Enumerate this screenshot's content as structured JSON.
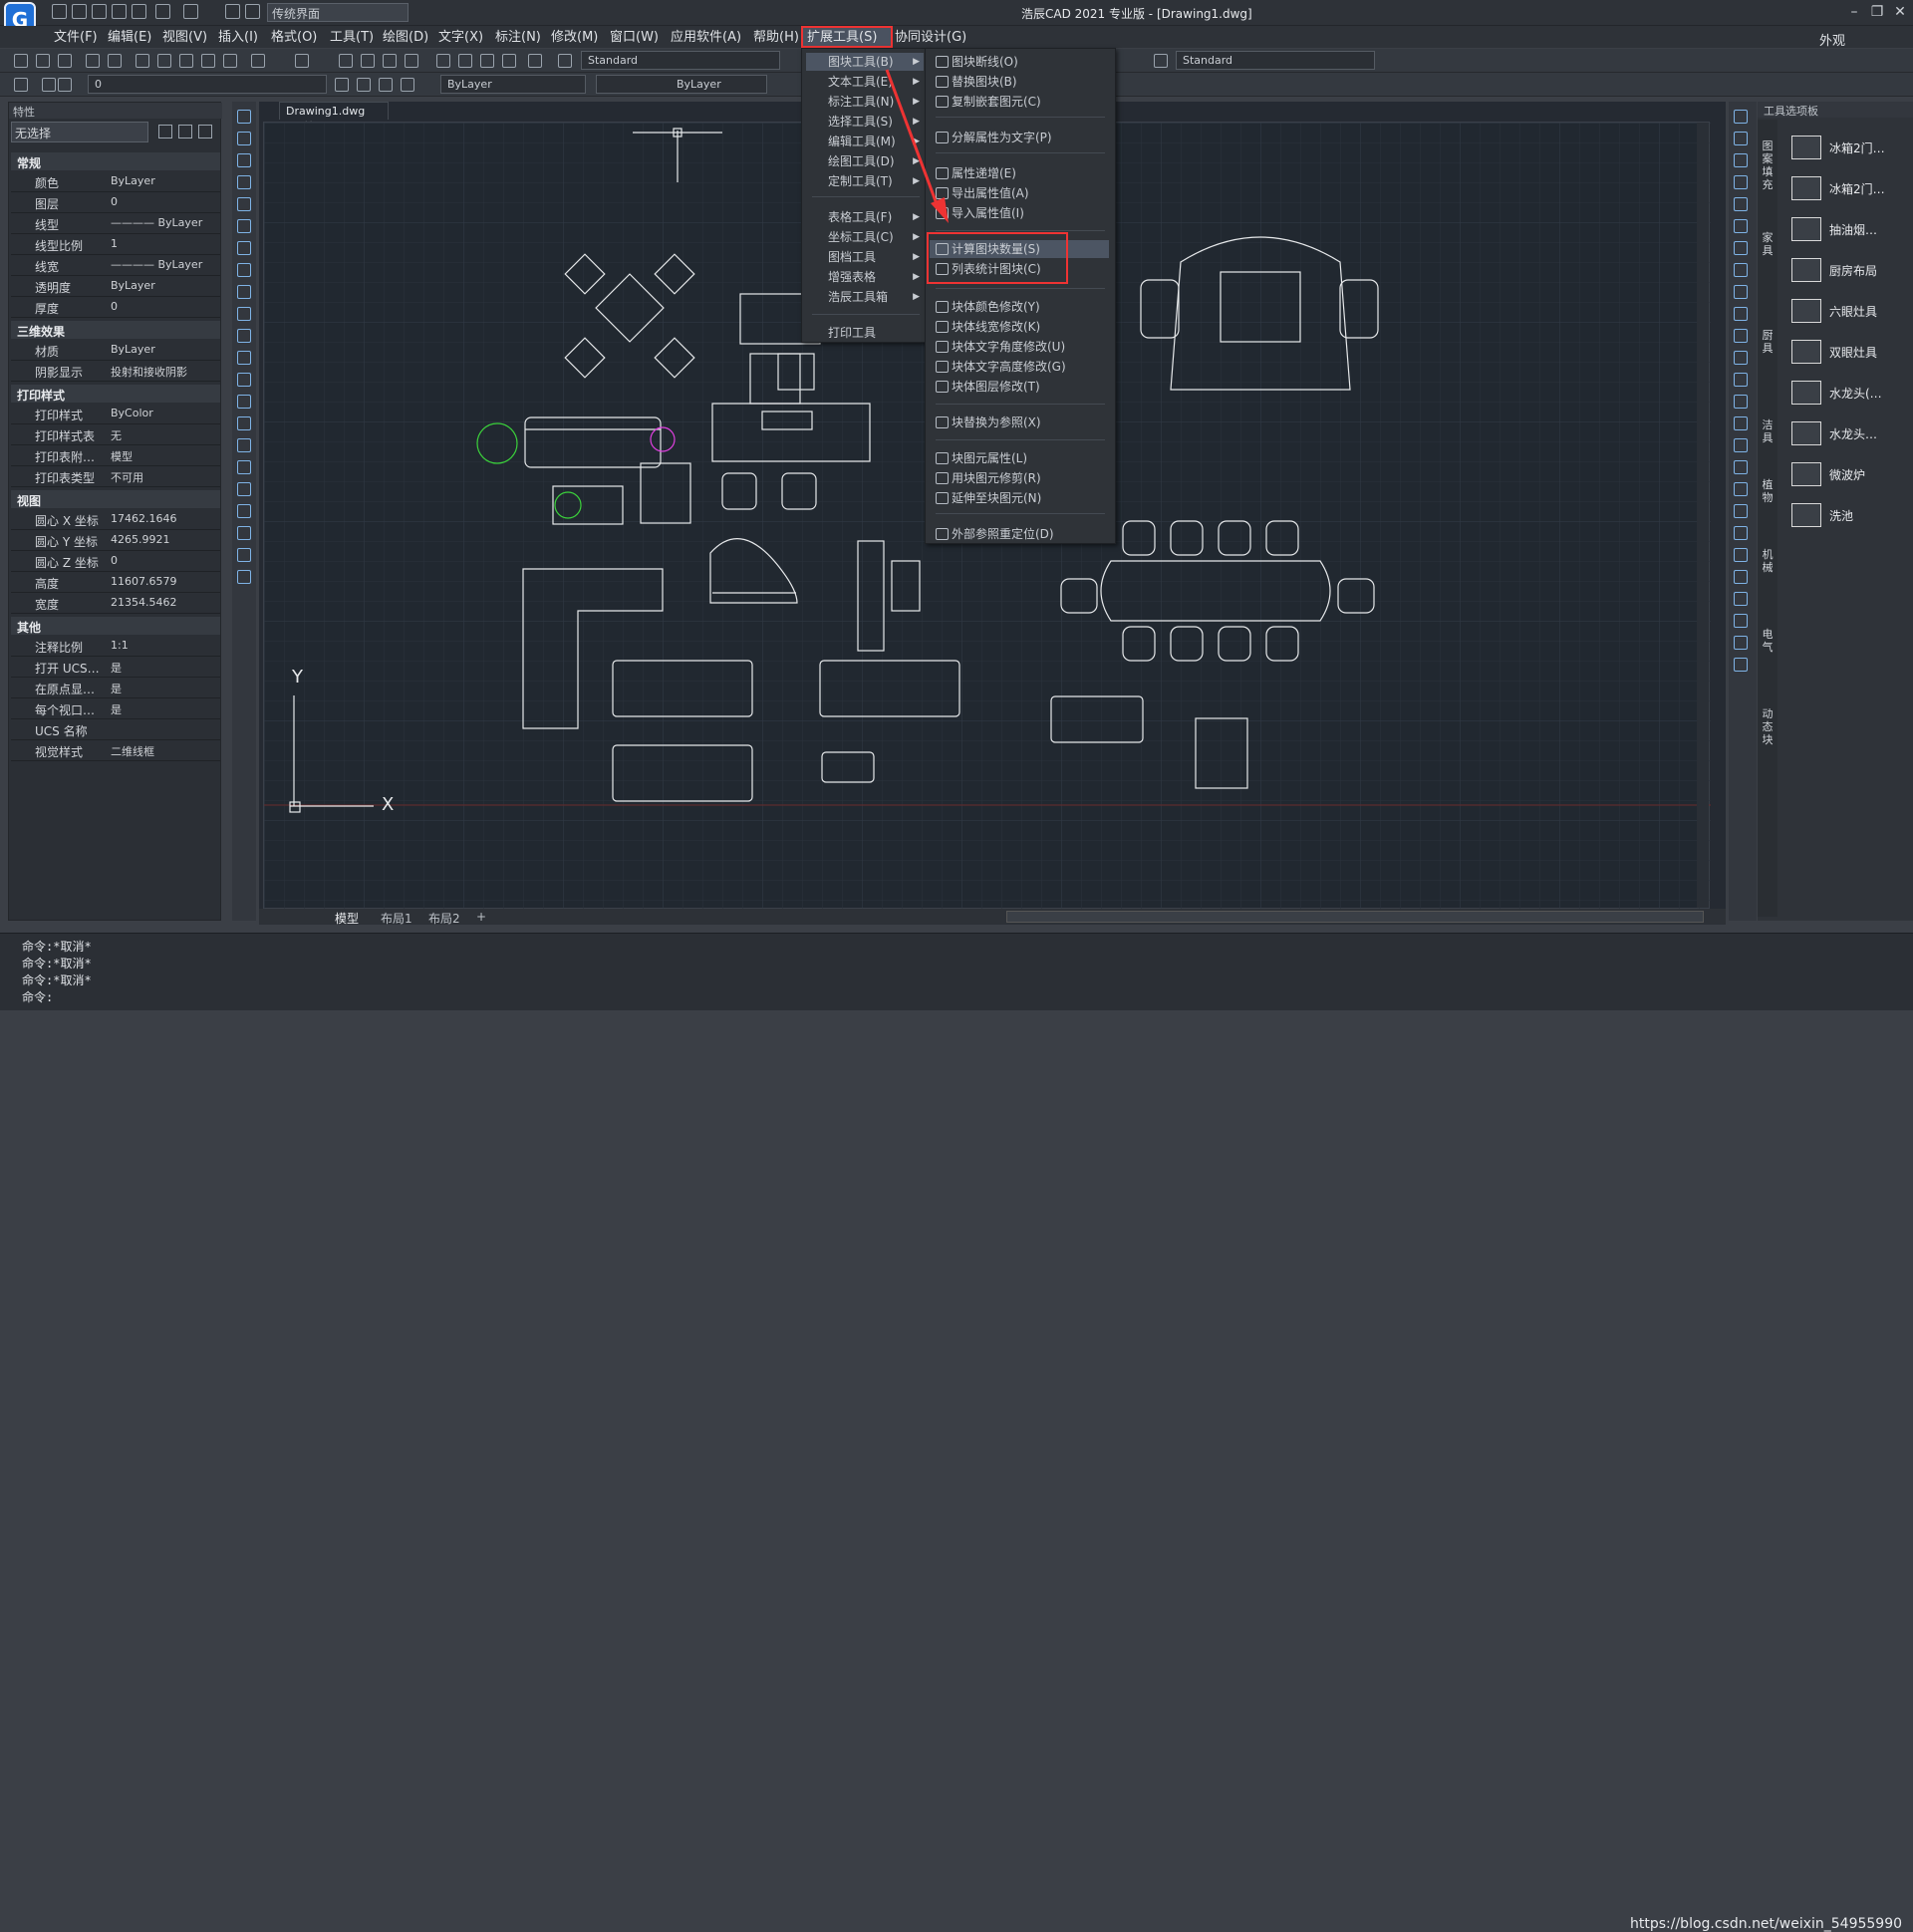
{
  "app": {
    "logo_letter": "G",
    "workspace": "传统界面",
    "window_title": "浩辰CAD 2021 专业版 - [Drawing1.dwg]",
    "outside_label": "外观",
    "min": "–",
    "max": "❐",
    "close": "✕"
  },
  "menubar": [
    "文件(F)",
    "编辑(E)",
    "视图(V)",
    "插入(I)",
    "格式(O)",
    "工具(T)",
    "绘图(D)",
    "文字(X)",
    "标注(N)",
    "修改(M)",
    "窗口(W)",
    "应用软件(A)",
    "帮助(H)",
    "扩展工具(S)",
    "协同设计(G)"
  ],
  "toolbar": {
    "text_style": "Standard",
    "dim_style": "Standard",
    "layer_value": "0",
    "color": "ByLayer",
    "linetype": "ByLayer",
    "lineweight": "ByLayer"
  },
  "properties": {
    "title": "特性",
    "selection": "无选择",
    "sections": [
      {
        "name": "常规",
        "rows": [
          [
            "颜色",
            "ByLayer"
          ],
          [
            "图层",
            "0"
          ],
          [
            "线型",
            "———— ByLayer"
          ],
          [
            "线型比例",
            "1"
          ],
          [
            "线宽",
            "———— ByLayer"
          ],
          [
            "透明度",
            "ByLayer"
          ],
          [
            "厚度",
            "0"
          ]
        ]
      },
      {
        "name": "三维效果",
        "rows": [
          [
            "材质",
            "ByLayer"
          ],
          [
            "阴影显示",
            "投射和接收阴影"
          ]
        ]
      },
      {
        "name": "打印样式",
        "rows": [
          [
            "打印样式",
            "ByColor"
          ],
          [
            "打印样式表",
            "无"
          ],
          [
            "打印表附…",
            "模型"
          ],
          [
            "打印表类型",
            "不可用"
          ]
        ]
      },
      {
        "name": "视图",
        "rows": [
          [
            "圆心 X 坐标",
            "17462.1646"
          ],
          [
            "圆心 Y 坐标",
            "4265.9921"
          ],
          [
            "圆心 Z 坐标",
            "0"
          ],
          [
            "高度",
            "11607.6579"
          ],
          [
            "宽度",
            "21354.5462"
          ]
        ]
      },
      {
        "name": "其他",
        "rows": [
          [
            "注释比例",
            "1:1"
          ],
          [
            "打开 UCS…",
            "是"
          ],
          [
            "在原点显…",
            "是"
          ],
          [
            "每个视口…",
            "是"
          ],
          [
            "UCS 名称",
            ""
          ],
          [
            "视觉样式",
            "二维线框"
          ]
        ]
      }
    ]
  },
  "document": {
    "tab": "Drawing1.dwg",
    "close": "×"
  },
  "layout_tabs": [
    "模型",
    "布局1",
    "布局2",
    "+"
  ],
  "menu_ext": [
    "图块工具(B)",
    "文本工具(E)",
    "标注工具(N)",
    "选择工具(S)",
    "编辑工具(M)",
    "绘图工具(D)",
    "定制工具(T)",
    "表格工具(F)",
    "坐标工具(C)",
    "图档工具",
    "增强表格",
    "浩辰工具箱",
    "打印工具"
  ],
  "submenu_block": [
    "图块断线(O)",
    "替换图块(B)",
    "复制嵌套图元(C)",
    "分解属性为文字(P)",
    "属性递增(E)",
    "导出属性值(A)",
    "导入属性值(I)",
    "计算图块数量(S)",
    "列表统计图块(C)",
    "块体颜色修改(Y)",
    "块体线宽修改(K)",
    "块体文字角度修改(U)",
    "块体文字高度修改(G)",
    "块体图层修改(T)",
    "块替换为参照(X)",
    "块图元属性(L)",
    "用块图元修剪(R)",
    "延伸至块图元(N)",
    "外部参照重定位(D)"
  ],
  "palette": {
    "title": "工具选项板",
    "tabs": [
      "图案填充",
      "家具",
      "厨具",
      "洁具",
      "植物",
      "机械",
      "电气",
      "动态块"
    ],
    "items": [
      "冰箱2门…",
      "冰箱2门…",
      "抽油烟…",
      "厨房布局",
      "六眼灶具",
      "双眼灶具",
      "水龙头(…",
      "水龙头…",
      "微波炉",
      "洗池"
    ]
  },
  "commands": [
    "命令:*取消*",
    "命令:*取消*",
    "命令:*取消*",
    "命令:"
  ],
  "watermark": "https://blog.csdn.net/weixin_54955990",
  "colors": {
    "highlight_border": "#e33333",
    "arrow": "#e33333",
    "canvas": "#212830"
  }
}
